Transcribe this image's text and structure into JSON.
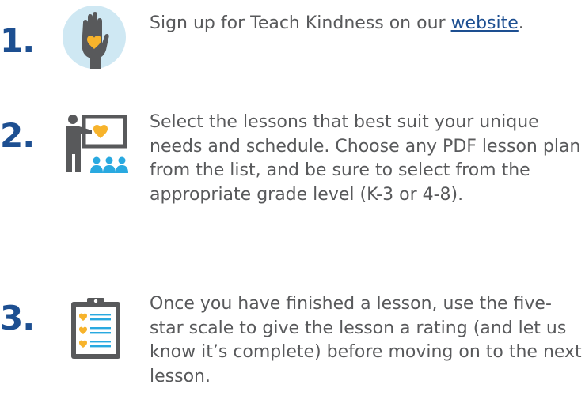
{
  "steps": [
    {
      "number": "1.",
      "icon": "raised-hand-heart-icon",
      "text_before": "Sign up for Teach Kindness on our ",
      "link_text": "website",
      "text_after": "."
    },
    {
      "number": "2.",
      "icon": "teacher-presentation-icon",
      "text": "Select the lessons that best suit your unique needs and schedule. Choose any PDF lesson plan from the list, and be sure to select from the appropriate grade level (K-3 or 4-8)."
    },
    {
      "number": "3.",
      "icon": "clipboard-checklist-icon",
      "text": "Once you have finished a lesson, use the five-star scale to give the lesson a rating (and let us know it’s complete) before moving on to the next lesson."
    }
  ],
  "colors": {
    "number": "#1d4f91",
    "body_text": "#58595b",
    "link": "#1d4f91",
    "heart": "#f7b32b",
    "icon_light_blue": "#cfe8f3",
    "icon_blue": "#29a9e0",
    "icon_gray": "#58595b"
  }
}
